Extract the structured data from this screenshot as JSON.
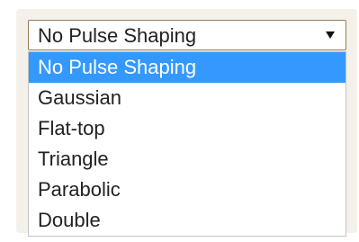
{
  "select": {
    "value": "No Pulse Shaping",
    "arrow_icon": "caret-down-icon"
  },
  "options": [
    {
      "label": "No Pulse Shaping",
      "highlighted": true
    },
    {
      "label": "Gaussian",
      "highlighted": false
    },
    {
      "label": "Flat-top",
      "highlighted": false
    },
    {
      "label": "Triangle",
      "highlighted": false
    },
    {
      "label": "Parabolic",
      "highlighted": false
    },
    {
      "label": "Double",
      "highlighted": false
    }
  ],
  "colors": {
    "highlight_bg": "#3399ff",
    "highlight_text": "#ffffff",
    "select_border": "#9a7a56",
    "list_border": "#c4c4c4",
    "frame_bg": "#f4f1ea"
  }
}
